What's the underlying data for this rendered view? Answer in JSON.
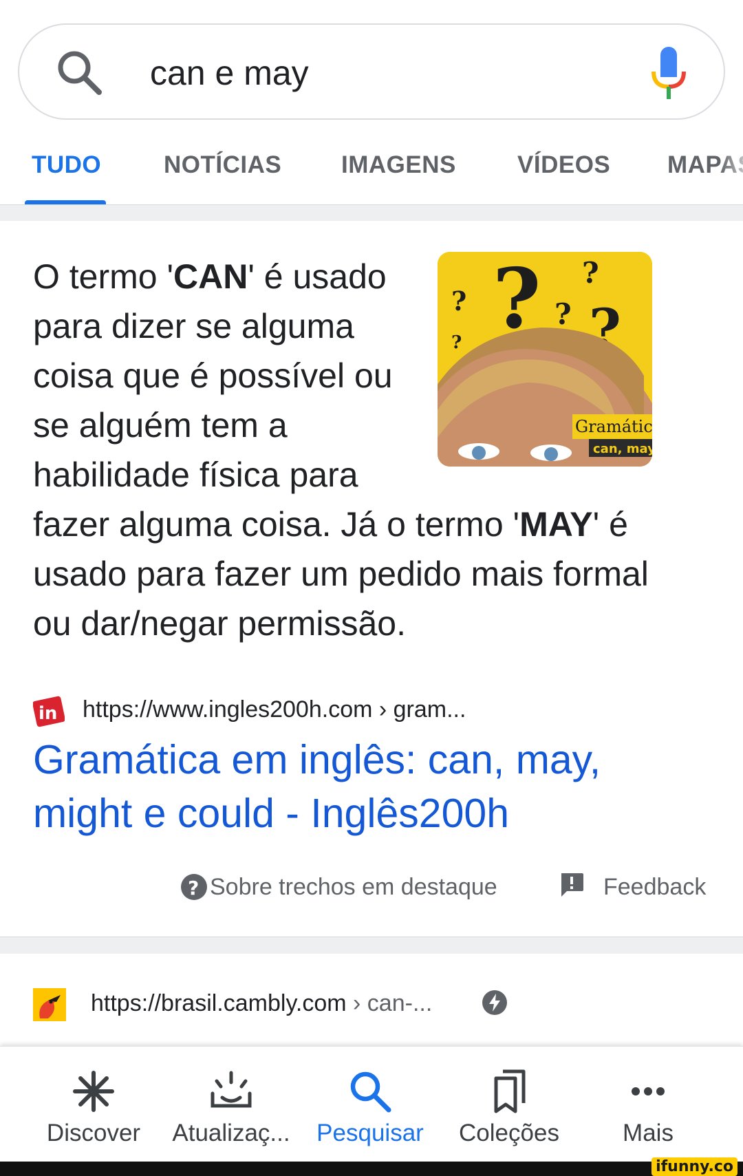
{
  "search": {
    "query": "can e may"
  },
  "tabs": [
    {
      "label": "TUDO",
      "active": true
    },
    {
      "label": "NOTÍCIAS"
    },
    {
      "label": "IMAGENS"
    },
    {
      "label": "VÍDEOS"
    },
    {
      "label": "MAPAS"
    }
  ],
  "snippet": {
    "text_1": "O termo '",
    "bold_1": "CAN",
    "text_2": "' é usado para dizer se alguma coisa que é possível ou se alguém tem a habilidade física para fazer alguma coisa. Já o termo '",
    "bold_2": "MAY",
    "text_3": "' é usado para fazer um pedido mais formal ou dar/negar permissão.",
    "thumb_caption_1": "Gramátic",
    "thumb_caption_2": "can, may",
    "source_favicon": "in",
    "source_url": "https://www.ingles200h.com › gram...",
    "title": "Gramática em inglês: can, may, might e could - Inglês200h",
    "about_label": "Sobre trechos em destaque",
    "feedback_label": "Feedback"
  },
  "result2": {
    "url_domain": "https://brasil.cambly.com",
    "url_crumb": " › can-..."
  },
  "bottom_nav": [
    {
      "label": "Discover",
      "icon": "asterisk-icon"
    },
    {
      "label": "Atualizaç...",
      "icon": "updates-icon"
    },
    {
      "label": "Pesquisar",
      "icon": "search-icon",
      "active": true
    },
    {
      "label": "Coleções",
      "icon": "collections-icon"
    },
    {
      "label": "Mais",
      "icon": "more-icon"
    }
  ],
  "watermark": "ifunny.co",
  "colors": {
    "accent": "#1a73e8",
    "link": "#1558d6",
    "text": "#202124",
    "muted": "#5f6368",
    "thumb_bg": "#f4cc1a"
  }
}
